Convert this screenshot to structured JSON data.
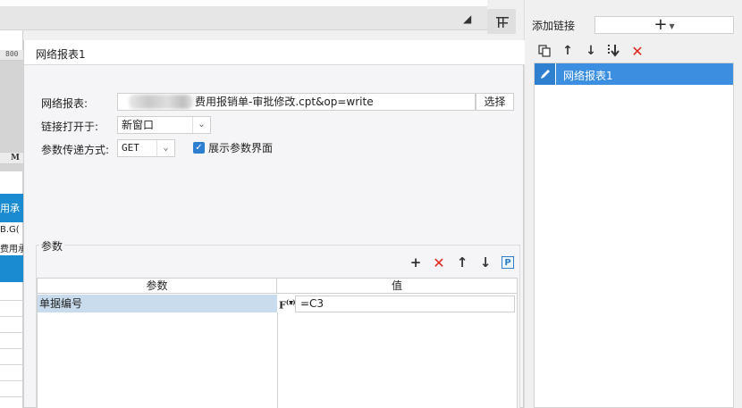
{
  "background": {
    "ruler_label": "800",
    "column_header": "M",
    "cell_1": "用承",
    "cell_2": "B.G(",
    "cell_3": "费用承"
  },
  "link_panel": {
    "add_link_label": "添加链接",
    "add_button": "+",
    "items": [
      {
        "label": "网络报表1"
      }
    ]
  },
  "dialog": {
    "title": "网络报表1",
    "report_label": "网络报表:",
    "report_value": "费用报销单-审批修改.cpt&op=write",
    "choose_button": "选择",
    "open_in_label": "链接打开于:",
    "open_in_value": "新窗口",
    "method_label": "参数传递方式:",
    "method_value": "GET",
    "show_params_label": "展示参数界面",
    "show_params_checked": true
  },
  "params": {
    "group_label": "参数",
    "columns": [
      "参数",
      "值"
    ],
    "rows": [
      {
        "name": "单据编号",
        "value": "=C3"
      }
    ]
  },
  "colors": {
    "selection_blue": "#3c8fe0",
    "row_highlight": "#c9dced",
    "delete_red": "#e0251b",
    "sheet_blue": "#1b8bd1"
  }
}
